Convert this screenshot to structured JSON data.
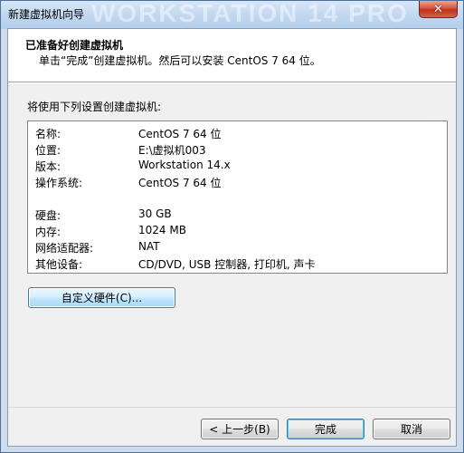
{
  "window": {
    "title": "新建虚拟机向导",
    "watermark": "WORKSTATION 14 PRO",
    "close_glyph": "✕"
  },
  "header": {
    "title": "已准备好创建虚拟机",
    "subtitle": "单击“完成”创建虚拟机。然后可以安装 CentOS 7 64 位。"
  },
  "intro": "将使用下列设置创建虚拟机:",
  "summary": [
    {
      "key": "名称:",
      "value": "CentOS 7 64 位"
    },
    {
      "key": "位置:",
      "value": "E:\\虚拟机003"
    },
    {
      "key": "版本:",
      "value": "Workstation 14.x"
    },
    {
      "key": "操作系统:",
      "value": "CentOS 7 64 位"
    },
    {
      "key": "硬盘:",
      "value": "30 GB"
    },
    {
      "key": "内存:",
      "value": "1024 MB"
    },
    {
      "key": "网络适配器:",
      "value": "NAT"
    },
    {
      "key": "其他设备:",
      "value": "CD/DVD, USB 控制器, 打印机, 声卡"
    }
  ],
  "buttons": {
    "customize": "自定义硬件(C)...",
    "back": "< 上一步(B)",
    "finish": "完成",
    "cancel": "取消"
  }
}
